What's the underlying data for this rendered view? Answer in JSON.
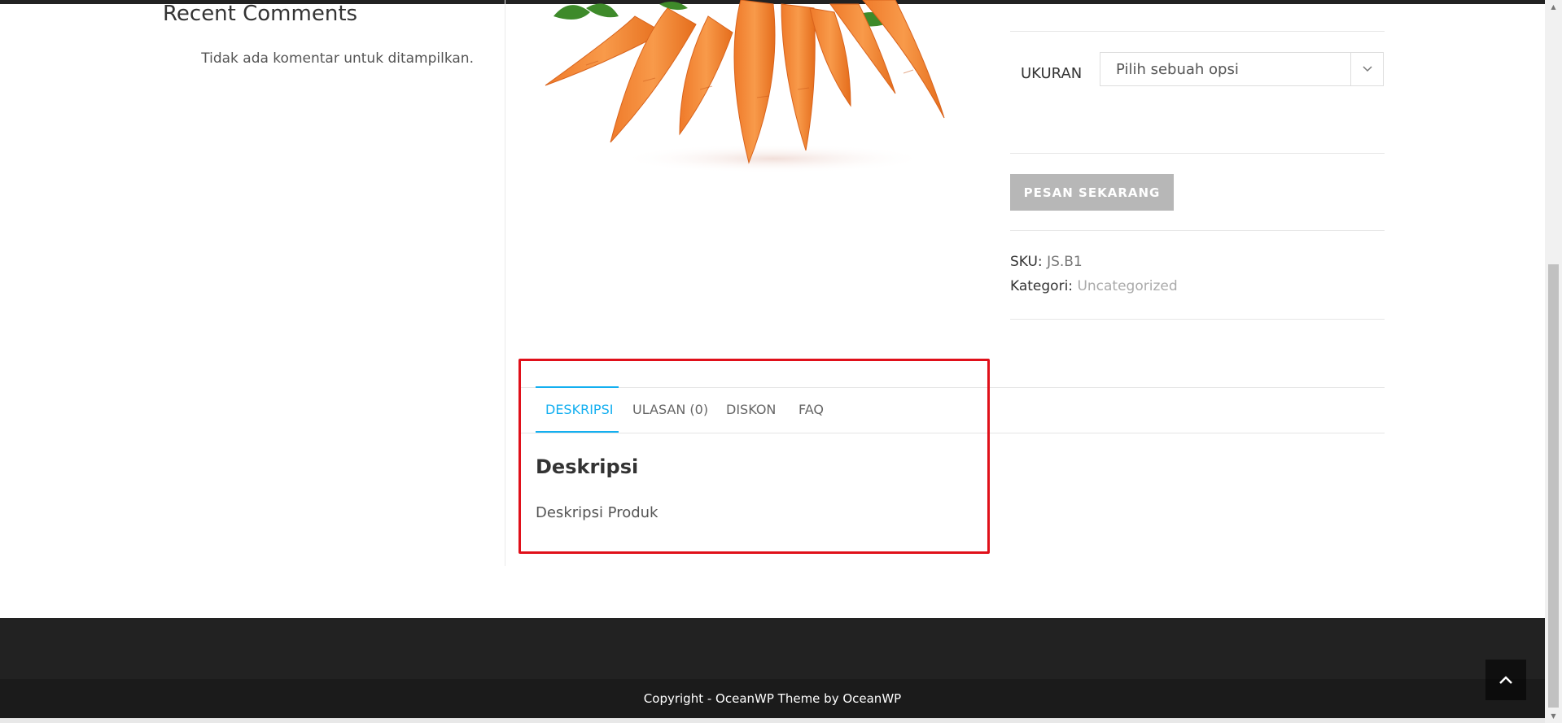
{
  "sidebar": {
    "recent_comments_title": "Recent Comments",
    "no_comments_text": "Tidak ada komentar untuk ditampilkan."
  },
  "product": {
    "image_icon": "carrots-product-image",
    "variation": {
      "label": "UKURAN",
      "select_value": "Pilih sebuah opsi"
    },
    "order_button_label": "PESAN SEKARANG",
    "sku_label": "SKU:",
    "sku_value": "JS.B1",
    "category_label": "Kategori:",
    "category_value": "Uncategorized"
  },
  "tabs": {
    "items": [
      {
        "label": "DESKRIPSI",
        "active": true
      },
      {
        "label": "ULASAN (0)",
        "active": false
      },
      {
        "label": "DISKON",
        "active": false
      },
      {
        "label": "FAQ",
        "active": false
      }
    ],
    "panel_title": "Deskripsi",
    "panel_text": "Deskripsi Produk"
  },
  "footer": {
    "copyright": "Copyright - OceanWP Theme by OceanWP"
  },
  "colors": {
    "accent": "#13aff0",
    "highlight": "#e0101a",
    "footer_bg": "#222222",
    "button_bg": "#b7b7b7"
  }
}
